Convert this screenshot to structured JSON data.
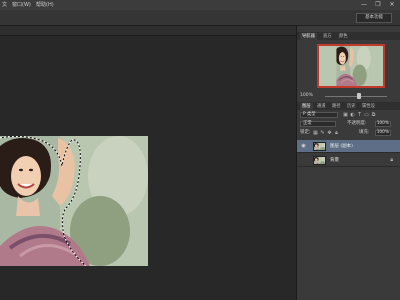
{
  "menubar": {
    "items": [
      "文",
      "窗口(W)",
      "帮助(H)"
    ],
    "window_controls": [
      "—",
      "❐",
      "✕"
    ]
  },
  "options": {
    "workspace_label": "基本功能"
  },
  "panels": {
    "navigator_tabs": [
      "导航器",
      "直方",
      "颜色"
    ],
    "zoom_level": "100%",
    "zoom_fraction": 0.55,
    "layers_tabs": [
      "图层",
      "通道",
      "路径",
      "历史",
      "属性设"
    ],
    "kind_label": "P 类型",
    "blend_mode": "正常",
    "opacity_label": "不透明度:",
    "opacity_value": "100%",
    "lock_label": "锁定:",
    "fill_label": "填充:",
    "fill_value": "100%"
  },
  "layers": [
    {
      "name": "图层 (副本)",
      "selected": true
    },
    {
      "name": "背景",
      "selected": false,
      "locked": true
    }
  ],
  "colors": {
    "accent_selection": "#5d6e86",
    "navigator_frame": "#c0392b",
    "workspace_bg": "#282828"
  }
}
